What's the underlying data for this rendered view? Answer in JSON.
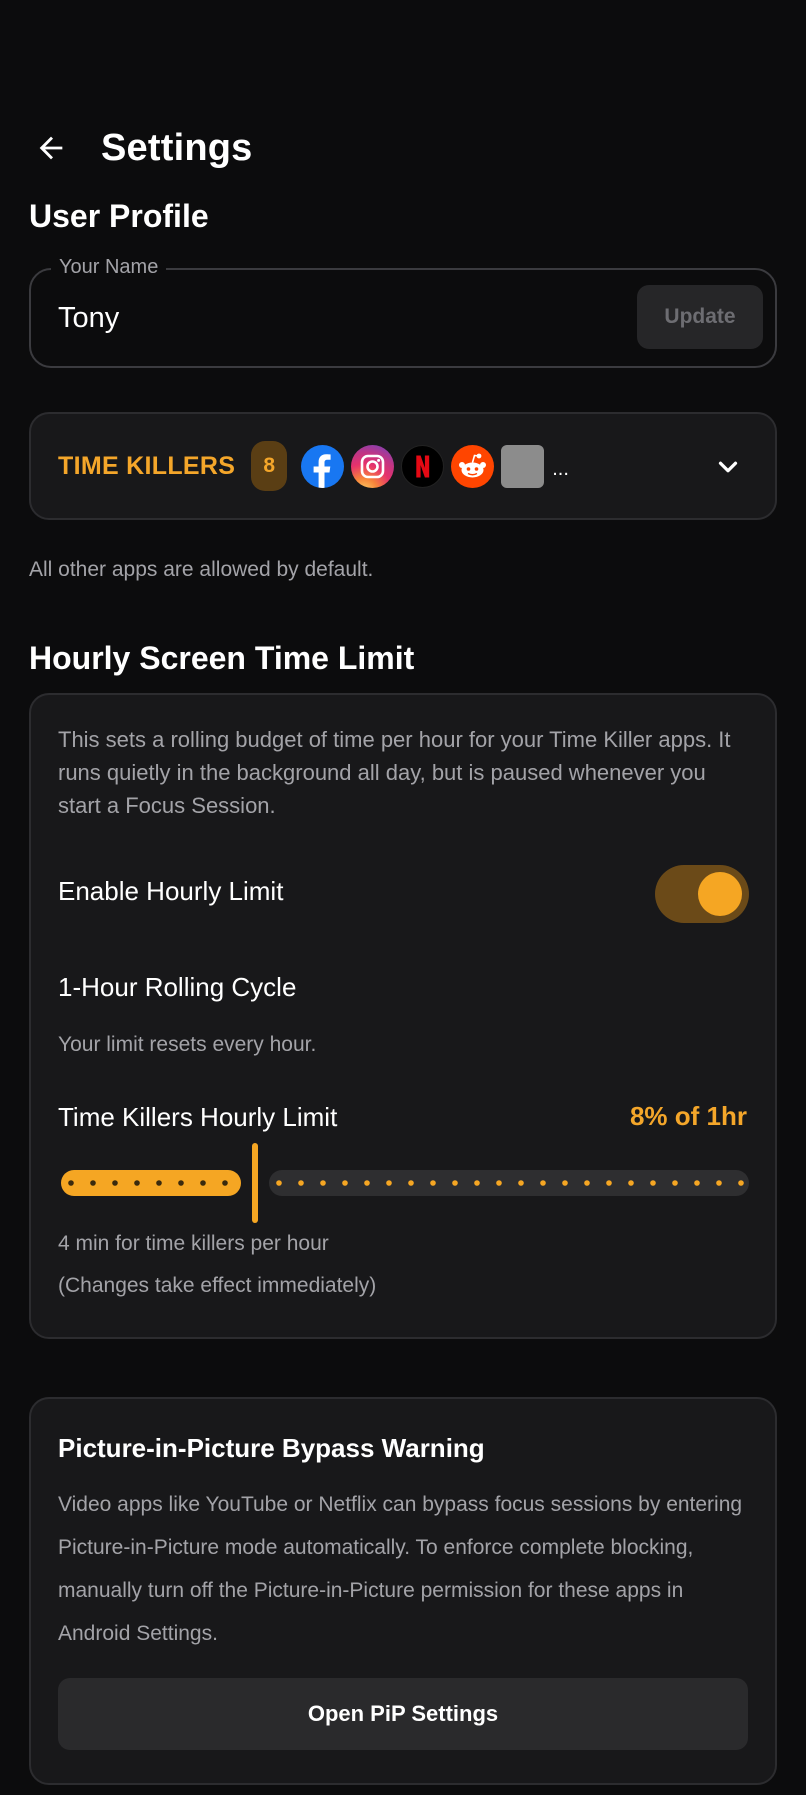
{
  "header": {
    "title": "Settings"
  },
  "user_profile": {
    "section_title": "User Profile",
    "name_label": "Your Name",
    "name_value": "Tony",
    "update_label": "Update"
  },
  "time_killers": {
    "label": "TIME KILLERS",
    "count": "8",
    "apps": [
      "facebook",
      "instagram",
      "netflix",
      "reddit",
      "generic-app"
    ],
    "more": "...",
    "helper": "All other apps are allowed by default."
  },
  "hourly": {
    "section_title": "Hourly Screen Time Limit",
    "description": "This sets a rolling budget of time per hour for your Time Killer apps. It runs quietly in the background all day, but is paused whenever you start a Focus Session.",
    "enable_label": "Enable Hourly Limit",
    "enabled": true,
    "cycle_label": "1-Hour Rolling Cycle",
    "cycle_note": "Your limit resets every hour.",
    "limit_label": "Time Killers Hourly Limit",
    "limit_value": "8% of 1hr",
    "limit_fraction": 0.08,
    "minutes_note": "4 min for time killers per hour",
    "effect_note": "(Changes take effect immediately)"
  },
  "pip": {
    "title": "Picture-in-Picture Bypass Warning",
    "body": "Video apps like YouTube or Netflix can bypass focus sessions by entering Picture-in-Picture mode automatically. To enforce complete blocking, manually turn off the Picture-in-Picture permission for these apps in Android Settings.",
    "button_label": "Open PiP Settings"
  },
  "colors": {
    "accent": "#f5a623",
    "background": "#0c0c0d",
    "card": "#18181a",
    "muted_text": "#a3a3a8"
  }
}
